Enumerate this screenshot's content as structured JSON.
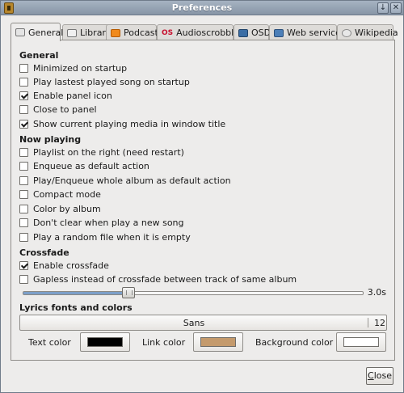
{
  "window": {
    "title": "Preferences",
    "minimize_glyph": "↓",
    "close_glyph": "✕"
  },
  "tabs": [
    {
      "label": "General",
      "icon": "general-icon",
      "active": true
    },
    {
      "label": "Library",
      "icon": "library-icon",
      "active": false
    },
    {
      "label": "Podcast",
      "icon": "podcast-rss-icon",
      "active": false
    },
    {
      "label": "Audioscrobbler",
      "icon": "audioscrobbler-icon",
      "active": false,
      "icon_text": "OS"
    },
    {
      "label": "OSD",
      "icon": "osd-icon",
      "active": false
    },
    {
      "label": "Web service",
      "icon": "web-service-icon",
      "active": false
    },
    {
      "label": "Wikipedia",
      "icon": "wikipedia-icon",
      "active": false
    }
  ],
  "general": {
    "heading": "General",
    "options": [
      {
        "label": "Minimized on startup",
        "checked": false
      },
      {
        "label": "Play lastest played song on startup",
        "checked": false
      },
      {
        "label": "Enable panel icon",
        "checked": true
      },
      {
        "label": "Close to panel",
        "checked": false
      },
      {
        "label": "Show current playing media in window title",
        "checked": true
      }
    ]
  },
  "now_playing": {
    "heading": "Now playing",
    "options": [
      {
        "label": "Playlist on the right (need restart)",
        "checked": false
      },
      {
        "label": "Enqueue as default action",
        "checked": false
      },
      {
        "label": "Play/Enqueue whole album as default action",
        "checked": false
      },
      {
        "label": "Compact mode",
        "checked": false
      },
      {
        "label": "Color by album",
        "checked": false
      },
      {
        "label": "Don't clear when play a new song",
        "checked": false
      },
      {
        "label": "Play a random file when it is empty",
        "checked": false
      }
    ]
  },
  "crossfade": {
    "heading": "Crossfade",
    "options": [
      {
        "label": "Enable crossfade",
        "checked": true
      },
      {
        "label": "Gapless instead of crossfade between track of same album",
        "checked": false
      }
    ],
    "slider_value_label": "3.0s",
    "slider_fraction": 0.31
  },
  "lyrics": {
    "heading": "Lyrics fonts and colors",
    "font_name": "Sans",
    "font_size": "12",
    "colors": [
      {
        "label": "Text color",
        "swatch": "#000000"
      },
      {
        "label": "Link color",
        "swatch": "#c49a6c"
      },
      {
        "label": "Background color",
        "swatch": "#ffffff"
      }
    ]
  },
  "footer": {
    "close_label_mnemonic": "C",
    "close_label_rest": "lose"
  }
}
